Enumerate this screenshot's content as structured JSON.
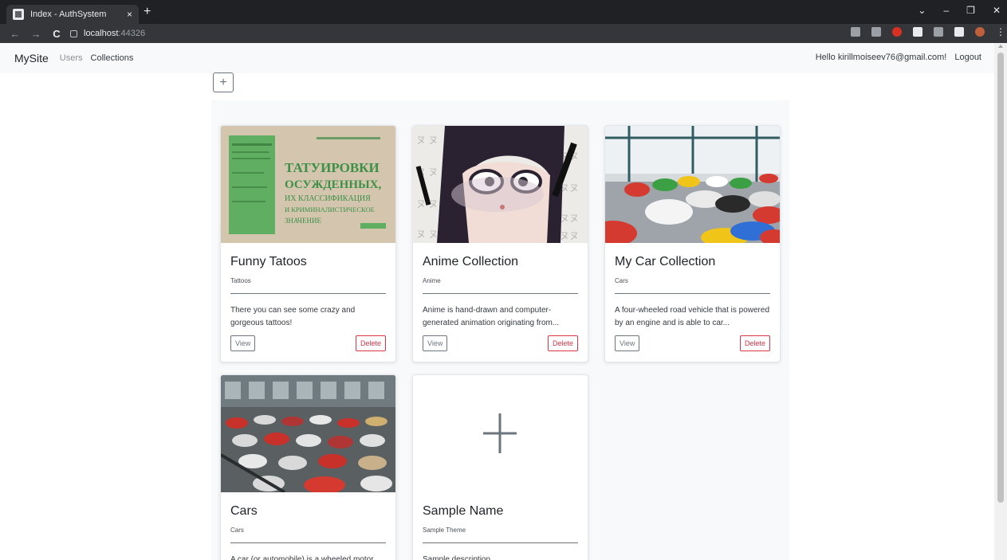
{
  "browser": {
    "tab_title": "Index - AuthSystem",
    "tab_close": "×",
    "new_tab": "+",
    "url_host": "localhost",
    "url_port": ":44326"
  },
  "navbar": {
    "brand": "MySite",
    "links": [
      "Users",
      "Collections"
    ],
    "greeting": "Hello kirillmoiseev76@gmail.com!",
    "logout": "Logout"
  },
  "add_button_label": "+",
  "cards": [
    {
      "title": "Funny Tatoos",
      "theme": "Tattoos",
      "description": "There you can see some crazy and gorgeous tattoos!",
      "view_label": "View",
      "delete_label": "Delete",
      "cover_lines": [
        "ТАТУИРОВКИ",
        "ОСУЖДЕННЫХ,",
        "ИХ КЛАССИФИКАЦИЯ",
        "И КРИМИНАЛИСТИЧЕСКОЕ",
        "ЗНАЧЕНИЕ"
      ]
    },
    {
      "title": "Anime Collection",
      "theme": "Anime",
      "description": "Anime is hand-drawn and computer-generated animation originating from...",
      "view_label": "View",
      "delete_label": "Delete"
    },
    {
      "title": "My Car Collection",
      "theme": "Cars",
      "description": "A four-wheeled road vehicle that is powered by an engine and is able to car...",
      "view_label": "View",
      "delete_label": "Delete"
    },
    {
      "title": "Cars",
      "theme": "Cars",
      "description": "A car (or automobile) is a wheeled motor"
    },
    {
      "title": "Sample Name",
      "theme": "Sample Theme",
      "description": "Sample description"
    }
  ],
  "colors": {
    "navbar_bg": "#f8f9fa",
    "danger": "#dc3545",
    "secondary": "#6c757d",
    "container_bg": "#f8f9fa"
  }
}
